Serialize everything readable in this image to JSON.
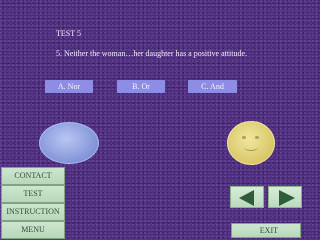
{
  "slide": {
    "title": "TEST 5",
    "question": "5. Neither the woman…her daughter has a positive attitude."
  },
  "answers": [
    {
      "label": "A. Nor"
    },
    {
      "label": "B. Or"
    },
    {
      "label": "C. And"
    }
  ],
  "sidebar": {
    "contact": "CONTACT",
    "test": "TEST",
    "instruction": "INSTRUCTION",
    "menu": "MENU"
  },
  "footer": {
    "exit": "EXIT"
  },
  "icons": {
    "prev": "triangle-left-icon",
    "next": "triangle-right-icon"
  },
  "colors": {
    "background": "#4a2a78",
    "answer_button": "#8e8de6",
    "nav_button": "#c6e0c8",
    "face_left": "#8f9fde",
    "face_right": "#d9c768"
  }
}
